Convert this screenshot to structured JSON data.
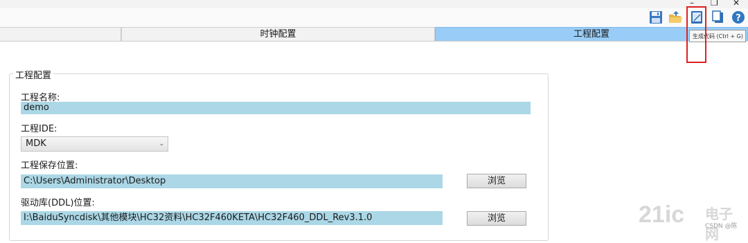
{
  "window": {
    "minimize_glyph": "–",
    "restore_glyph": "❐",
    "close_glyph": "✕"
  },
  "toolbar": {
    "icons": [
      "save-icon",
      "open-folder-icon",
      "generate-code-icon",
      "copy-icon",
      "help-icon"
    ],
    "tooltip": "生成代码 (Ctrl + G)"
  },
  "tabs": [
    {
      "label": ""
    },
    {
      "label": "时钟配置"
    },
    {
      "label": "工程配置",
      "active": true
    }
  ],
  "project_config": {
    "group_title": "工程配置",
    "name_label": "工程名称:",
    "name_value": "demo",
    "ide_label": "工程IDE:",
    "ide_value": "MDK",
    "save_path_label": "工程保存位置:",
    "save_path_value": "C:\\Users\\Administrator\\Desktop",
    "browse_label": "浏览",
    "ddl_path_label": "驱动库(DDL)位置:",
    "ddl_path_value": "I:\\BaiduSyncdisk\\其他模块\\HC32资料\\HC32F460KETA\\HC32F460_DDL_Rev3.1.0",
    "browse2_label": "浏览"
  },
  "watermark": {
    "logo": "21ic",
    "site": "电子网",
    "sub": "CSDN @陈"
  },
  "colors": {
    "tab_active": "#99cdf7",
    "field_bg": "#abd7e6",
    "highlight_red": "#e02020"
  }
}
